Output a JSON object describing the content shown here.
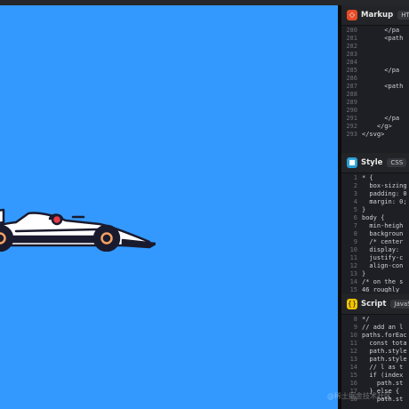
{
  "preview": {
    "background": "#3399ff"
  },
  "panels": {
    "markup": {
      "title": "Markup",
      "language": "HTML",
      "badge_color": "#e34c26",
      "lines": [
        {
          "n": "280",
          "t": "      </pa"
        },
        {
          "n": "281",
          "t": "      <path"
        },
        {
          "n": "282",
          "t": ""
        },
        {
          "n": "283",
          "t": ""
        },
        {
          "n": "284",
          "t": ""
        },
        {
          "n": "285",
          "t": "      </pa"
        },
        {
          "n": "286",
          "t": ""
        },
        {
          "n": "287",
          "t": "      <path"
        },
        {
          "n": "288",
          "t": ""
        },
        {
          "n": "289",
          "t": ""
        },
        {
          "n": "290",
          "t": ""
        },
        {
          "n": "291",
          "t": "      </pa"
        },
        {
          "n": "292",
          "t": "    </g>"
        },
        {
          "n": "293",
          "t": "</svg>"
        }
      ]
    },
    "style": {
      "title": "Style",
      "language": "CSS",
      "badge_color": "#2a9fd6",
      "lines": [
        {
          "n": "1",
          "t": "* {"
        },
        {
          "n": "2",
          "t": "  box-sizing"
        },
        {
          "n": "3",
          "t": "  padding: 0"
        },
        {
          "n": "4",
          "t": "  margin: 0;"
        },
        {
          "n": "5",
          "t": "}"
        },
        {
          "n": "6",
          "t": "body {"
        },
        {
          "n": "7",
          "t": "  min-heigh"
        },
        {
          "n": "8",
          "t": "  backgroun"
        },
        {
          "n": "9",
          "t": "  /* center"
        },
        {
          "n": "10",
          "t": "  display: "
        },
        {
          "n": "11",
          "t": "  justify-c"
        },
        {
          "n": "12",
          "t": "  align-con"
        },
        {
          "n": "13",
          "t": "}"
        },
        {
          "n": "14",
          "t": "/* on the s"
        },
        {
          "n": "15",
          "t": "46 roughly "
        }
      ]
    },
    "script": {
      "title": "Script",
      "language": "JavaScript",
      "badge_color": "#f0c400",
      "lines": [
        {
          "n": "8",
          "t": "*/"
        },
        {
          "n": "9",
          "t": "// add an l"
        },
        {
          "n": "10",
          "t": "paths.forEac"
        },
        {
          "n": "11",
          "t": "  const tota"
        },
        {
          "n": "12",
          "t": "  path.style"
        },
        {
          "n": "13",
          "t": "  path.style"
        },
        {
          "n": "14",
          "t": "  // l as t"
        },
        {
          "n": "15",
          "t": "  if (index"
        },
        {
          "n": "16",
          "t": "    path.st"
        },
        {
          "n": "17",
          "t": "  } else {"
        },
        {
          "n": "18",
          "t": "    path.st"
        }
      ]
    }
  },
  "watermark": "@稀土掘金技术社区"
}
